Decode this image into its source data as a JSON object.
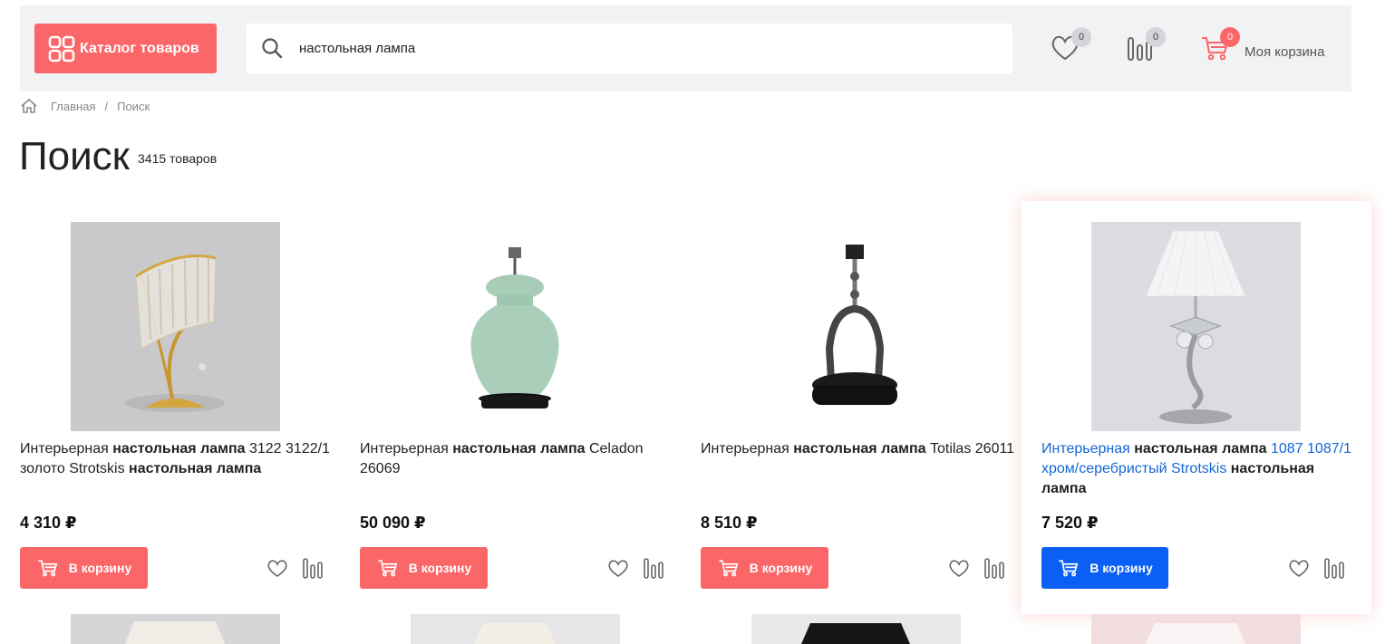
{
  "header": {
    "catalog_label": "Каталог товаров",
    "search_value": "настольная лампа",
    "favorites_count": "0",
    "compare_count": "0",
    "cart_count": "0",
    "cart_label": "Моя корзина",
    "accent_color": "#fb6668"
  },
  "breadcrumb": {
    "home": "Главная",
    "separator": "/",
    "current": "Поиск"
  },
  "page": {
    "title": "Поиск",
    "count": "3415 товаров"
  },
  "products": [
    {
      "name_parts": [
        "Интерьерная ",
        "настольная лампа",
        " 3122 3122/1 золото Strotskis ",
        "настольная лампа"
      ],
      "price": "4 310 ₽",
      "button": "В корзину"
    },
    {
      "name_parts": [
        "Интерьерная ",
        "настольная лампа",
        " Celadon 26069",
        ""
      ],
      "price": "50 090 ₽",
      "button": "В корзину"
    },
    {
      "name_parts": [
        "Интерьерная ",
        "настольная лампа",
        " Totilas 26011",
        ""
      ],
      "price": "8 510 ₽",
      "button": "В корзину"
    },
    {
      "name_parts": [
        "Интерьерная ",
        "настольная лампа",
        " 1087 1087/1 хром/серебристый Strotskis ",
        "настольная лампа"
      ],
      "price": "7 520 ₽",
      "button": "В корзину"
    }
  ],
  "icons": {
    "catalog": "grid-icon",
    "search": "search-icon",
    "favorites": "heart-icon",
    "compare": "compare-bars-icon",
    "cart": "cart-icon",
    "home": "home-icon"
  }
}
